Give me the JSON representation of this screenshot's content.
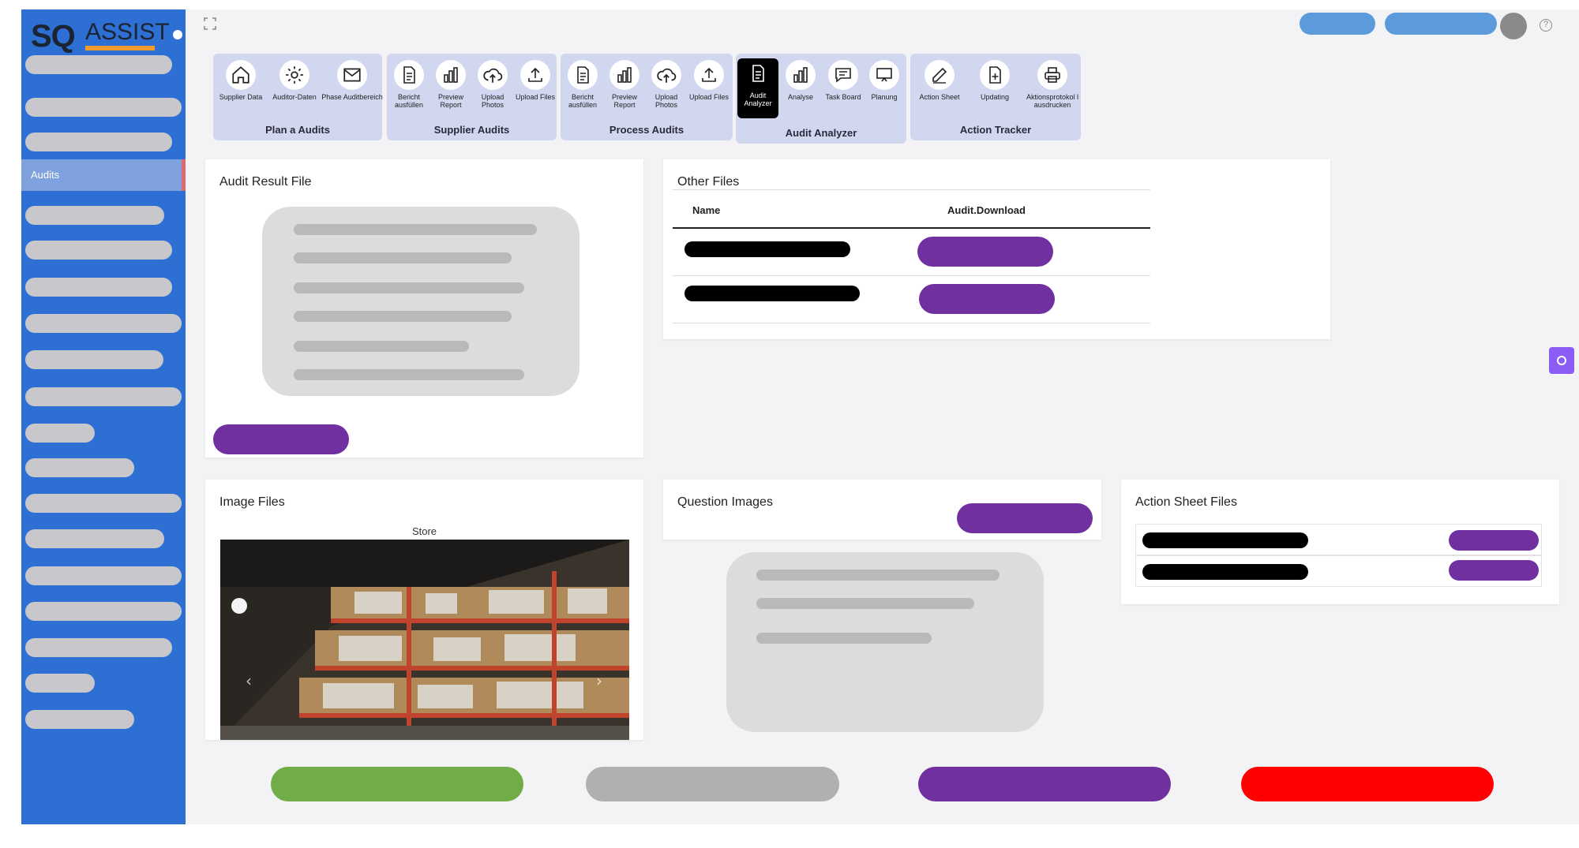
{
  "sidebar": {
    "logo_sq": "SQ",
    "logo_assist": "ASSIST",
    "active_item": "Audits"
  },
  "toolbar": {
    "groups": [
      {
        "title": "Plan a Audits",
        "items": [
          "Supplier Data",
          "Auditor-Daten",
          "Phase Auditbereich"
        ]
      },
      {
        "title": "Supplier Audits",
        "items": [
          "Bericht ausfüllen",
          "Preview Report",
          "Upload Photos",
          "Upload Files"
        ]
      },
      {
        "title": "Process Audits",
        "items": [
          "Bericht ausfüllen",
          "Preview Report",
          "Upload Photos",
          "Upload Files"
        ]
      },
      {
        "title": "Audit Analyzer",
        "items": [
          "Audit Analyzer",
          "Analyse",
          "Task Board",
          "Planung"
        ]
      },
      {
        "title": "Action Tracker",
        "items": [
          "Action Sheet",
          "Updating",
          "Aktionsprotokol l ausdrucken"
        ]
      }
    ]
  },
  "audit_result": {
    "title": "Audit Result File"
  },
  "other_files": {
    "title": "Other Files",
    "col_name": "Name",
    "col_download": "Audit.Download"
  },
  "image_files": {
    "title": "Image Files",
    "caption": "Store"
  },
  "question_images": {
    "title": "Question Images"
  },
  "action_sheet_files": {
    "title": "Action Sheet Files"
  },
  "help_icon": "?",
  "colors": {
    "sidebar": "#2e6fd4",
    "accent_purple": "#7030a0",
    "green": "#70ad47",
    "gray": "#b0b0b0",
    "red": "#ff0000",
    "toolbar_group": "#d2d7f0"
  },
  "icons": [
    "home-icon",
    "gear-icon",
    "mail-icon",
    "document-icon",
    "bar-chart-icon",
    "upload-cloud-icon",
    "upload-icon",
    "message-icon",
    "presentation-icon",
    "edit-icon",
    "file-plus-icon",
    "printer-icon",
    "expand-icon",
    "help-icon"
  ]
}
